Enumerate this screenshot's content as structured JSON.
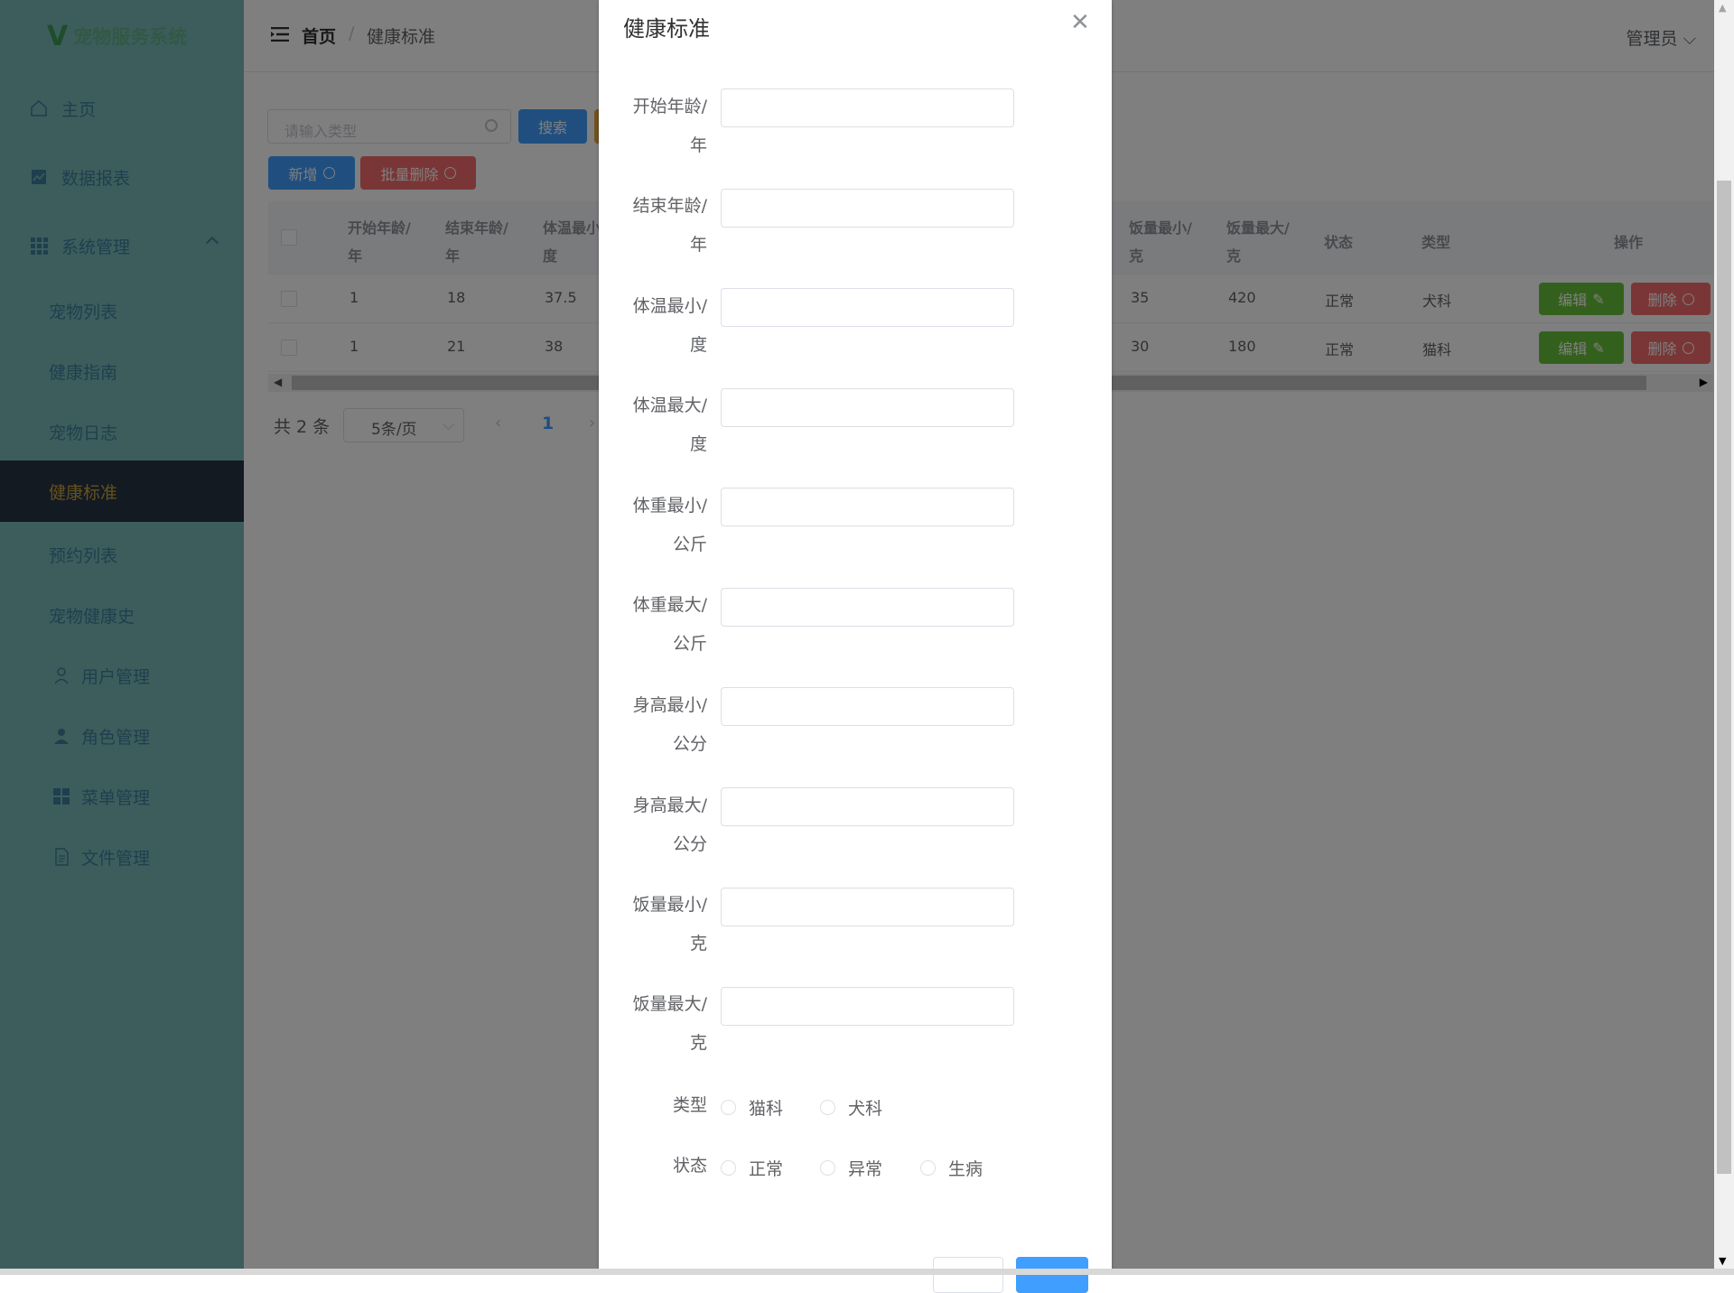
{
  "app": {
    "title": "宠物服务系统"
  },
  "sidebar": {
    "items": [
      {
        "label": "主页"
      },
      {
        "label": "数据报表"
      },
      {
        "label": "系统管理"
      },
      {
        "label": "宠物列表"
      },
      {
        "label": "健康指南"
      },
      {
        "label": "宠物日志"
      },
      {
        "label": "健康标准"
      },
      {
        "label": "预约列表"
      },
      {
        "label": "宠物健康史"
      },
      {
        "label": "用户管理"
      },
      {
        "label": "角色管理"
      },
      {
        "label": "菜单管理"
      },
      {
        "label": "文件管理"
      }
    ],
    "active": "健康标准"
  },
  "header": {
    "breadcrumb_home": "首页",
    "breadcrumb_sep": "/",
    "breadcrumb_current": "健康标准",
    "user": "管理员"
  },
  "toolbar": {
    "search_placeholder": "请输入类型",
    "search_label": "搜索",
    "add_label": "新增",
    "batch_delete_label": "批量删除"
  },
  "table": {
    "columns_left": [
      {
        "line1": "开始年龄/",
        "line2": "年"
      },
      {
        "line1": "结束年龄/",
        "line2": "年"
      },
      {
        "line1": "体温最小/",
        "line2": "度"
      }
    ],
    "columns_right": [
      {
        "line1": "饭量最小/",
        "line2": "克"
      },
      {
        "line1": "饭量最大/",
        "line2": "克"
      },
      {
        "line1": "状态",
        "line2": ""
      },
      {
        "line1": "类型",
        "line2": ""
      }
    ],
    "action_header": "操作",
    "rows": [
      {
        "start_age": "1",
        "end_age": "18",
        "temp_min": "37.5",
        "food_min": "35",
        "food_max": "420",
        "status": "正常",
        "type": "犬科"
      },
      {
        "start_age": "1",
        "end_age": "21",
        "temp_min": "38",
        "food_min": "30",
        "food_max": "180",
        "status": "正常",
        "type": "猫科"
      }
    ],
    "edit_label": "编辑",
    "delete_label": "删除"
  },
  "pager": {
    "total": "共 2 条",
    "page_size": "5条/页",
    "current_page": "1"
  },
  "dialog": {
    "title": "健康标准",
    "fields": [
      {
        "l1": "开始年龄/",
        "l2": "年",
        "value": ""
      },
      {
        "l1": "结束年龄/",
        "l2": "年",
        "value": ""
      },
      {
        "l1": "体温最小/",
        "l2": "度",
        "value": ""
      },
      {
        "l1": "体温最大/",
        "l2": "度",
        "value": ""
      },
      {
        "l1": "体重最小/",
        "l2": "公斤",
        "value": ""
      },
      {
        "l1": "体重最大/",
        "l2": "公斤",
        "value": ""
      },
      {
        "l1": "身高最小/",
        "l2": "公分",
        "value": ""
      },
      {
        "l1": "身高最大/",
        "l2": "公分",
        "value": ""
      },
      {
        "l1": "饭量最小/",
        "l2": "克",
        "value": ""
      },
      {
        "l1": "饭量最大/",
        "l2": "克",
        "value": ""
      }
    ],
    "type_label": "类型",
    "type_options": [
      "猫科",
      "犬科"
    ],
    "status_label": "状态",
    "status_options": [
      "正常",
      "异常",
      "生病"
    ]
  },
  "colors": {
    "primary": "#409eff",
    "danger": "#f56c6c",
    "success": "#67c23a",
    "sidebar": "#7bbab9",
    "active_bg": "#263445",
    "active_text": "#c9a341"
  }
}
